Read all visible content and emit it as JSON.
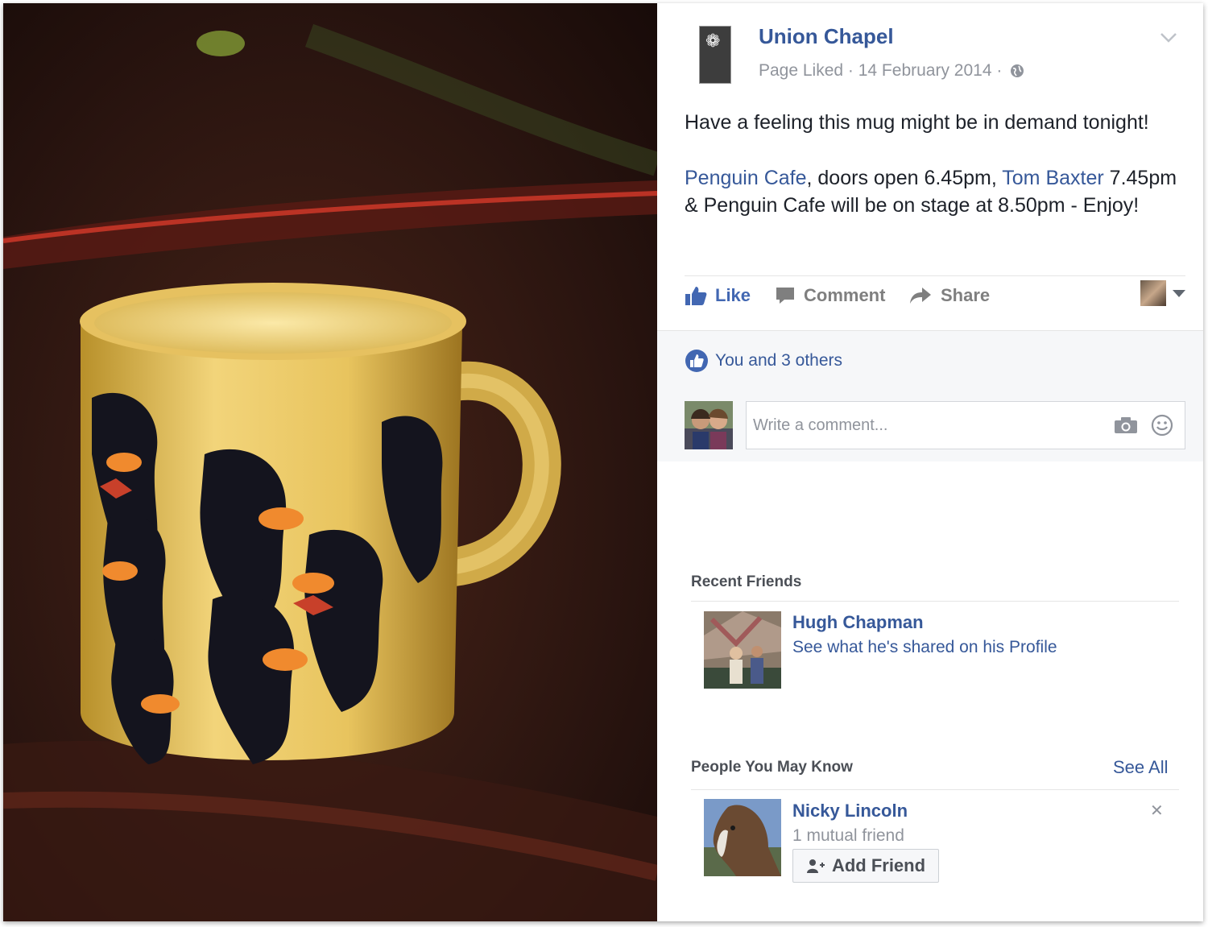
{
  "post": {
    "page_name": "Union Chapel",
    "logo_icon": "union-chapel-flower-logo",
    "meta": "Page Liked · 14 February 2014 ·",
    "audience_icon": "globe-icon",
    "line1": "Have a feeling this mug might be in demand tonight!",
    "mention1": "Penguin Cafe",
    "text1": ", doors open 6.45pm, ",
    "mention2": "Tom Baxter",
    "text2": " 7.45pm & Penguin Cafe will be on stage at 8.50pm - Enjoy!"
  },
  "actions": {
    "like": "Like",
    "comment": "Comment",
    "share": "Share"
  },
  "likes_summary": "You and 3 others",
  "comment_input": {
    "placeholder": "Write a comment..."
  },
  "recent_friends": {
    "title": "Recent Friends",
    "items": [
      {
        "name": "Hugh Chapman",
        "subtitle": "See what he's shared on his Profile"
      }
    ]
  },
  "people_you_may_know": {
    "title": "People You May Know",
    "see_all": "See All",
    "items": [
      {
        "name": "Nicky Lincoln",
        "subtitle": "1 mutual friend",
        "button": "Add Friend"
      }
    ]
  },
  "colors": {
    "link_blue": "#365899",
    "like_blue": "#4267b2",
    "gray_text": "#90949c",
    "comment_bg": "#f6f7f9"
  }
}
